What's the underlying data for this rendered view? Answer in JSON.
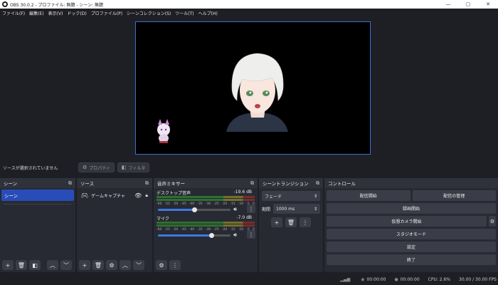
{
  "window": {
    "title": "OBS 30.0.2 - プロファイル: 無題 - シーン: 無題",
    "minimize": "—",
    "maximize": "▢",
    "close": "✕"
  },
  "menu": [
    "ファイル(F)",
    "編集(E)",
    "表示(V)",
    "ドック(D)",
    "プロファイル(P)",
    "シーンコレクション(S)",
    "ツール(T)",
    "ヘルプ(H)"
  ],
  "source_bar": {
    "no_selection": "ソースが選択されていません",
    "properties": "プロパティ",
    "filters": "フィルタ"
  },
  "scenes": {
    "title": "シーン",
    "items": [
      "シーン"
    ]
  },
  "sources": {
    "title": "ソース",
    "items": [
      {
        "name": "ゲームキャプチャ"
      }
    ]
  },
  "mixer": {
    "title": "音声ミキサー",
    "ticks": [
      "-60",
      "-55",
      "-50",
      "-45",
      "-40",
      "-35",
      "-30",
      "-25",
      "-20",
      "-15",
      "-10",
      "-5",
      "0"
    ],
    "channels": [
      {
        "name": "デスクトップ音声",
        "db": "-19.6 dB",
        "volume": 0.5
      },
      {
        "name": "マイク",
        "db": "-7.0 dB",
        "volume": 0.74
      }
    ]
  },
  "transitions": {
    "title": "シーントランジション",
    "type": "フェード",
    "duration_label": "期間",
    "duration": "1000 ms"
  },
  "controls": {
    "title": "コントロール",
    "start_streaming": "配信開始",
    "manage_broadcast": "配信の管理",
    "start_recording": "録画開始",
    "start_virtual_cam": "仮想カメラ開始",
    "studio_mode": "スタジオモード",
    "settings": "設定",
    "exit": "終了"
  },
  "status": {
    "stream_time": "00:00:00",
    "record_time": "00:00:00",
    "cpu": "CPU: 2.6%",
    "fps": "30.00 / 30.00 FPS"
  },
  "colors": {
    "accent": "#284cb8",
    "canvas_border": "#3b6fd4",
    "panel": "#272a33",
    "background": "#1e1f24"
  }
}
